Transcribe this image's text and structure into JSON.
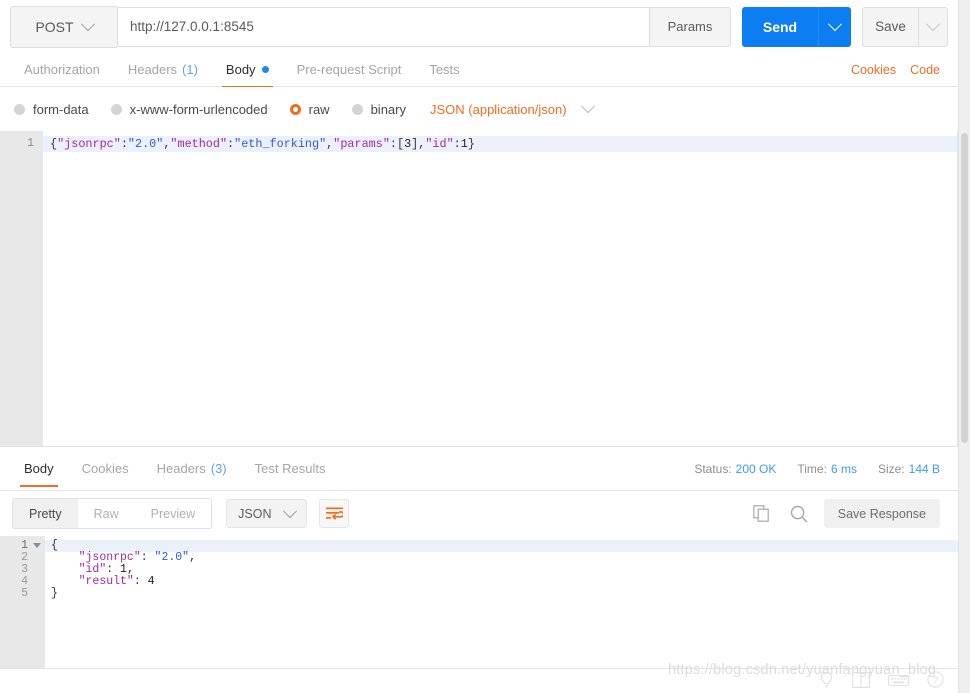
{
  "request": {
    "method": "POST",
    "url": "http://127.0.0.1:8545",
    "params_label": "Params",
    "send_label": "Send",
    "save_label": "Save",
    "tabs": [
      {
        "label": "Authorization",
        "count": "",
        "active": false,
        "dot": false
      },
      {
        "label": "Headers",
        "count": "(1)",
        "active": false,
        "dot": false
      },
      {
        "label": "Body",
        "count": "",
        "active": true,
        "dot": true
      },
      {
        "label": "Pre-request Script",
        "count": "",
        "active": false,
        "dot": false
      },
      {
        "label": "Tests",
        "count": "",
        "active": false,
        "dot": false
      }
    ],
    "right_links": [
      {
        "label": "Cookies"
      },
      {
        "label": "Code"
      }
    ],
    "body_types": [
      {
        "label": "form-data",
        "checked": false
      },
      {
        "label": "x-www-form-urlencoded",
        "checked": false
      },
      {
        "label": "raw",
        "checked": true
      },
      {
        "label": "binary",
        "checked": false
      }
    ],
    "content_type": "JSON (application/json)",
    "body_lines": [
      {
        "number": "1",
        "tokens": [
          {
            "t": "{",
            "k": "pun"
          },
          {
            "t": "\"jsonrpc\"",
            "k": "key"
          },
          {
            "t": ":",
            "k": "pun"
          },
          {
            "t": "\"2.0\"",
            "k": "str"
          },
          {
            "t": ",",
            "k": "pun"
          },
          {
            "t": "\"method\"",
            "k": "key"
          },
          {
            "t": ":",
            "k": "pun"
          },
          {
            "t": "\"eth_forking\"",
            "k": "str"
          },
          {
            "t": ",",
            "k": "pun"
          },
          {
            "t": "\"params\"",
            "k": "key"
          },
          {
            "t": ":[",
            "k": "pun"
          },
          {
            "t": "3",
            "k": "num"
          },
          {
            "t": "],",
            "k": "pun"
          },
          {
            "t": "\"id\"",
            "k": "key"
          },
          {
            "t": ":",
            "k": "pun"
          },
          {
            "t": "1",
            "k": "num"
          },
          {
            "t": "}",
            "k": "pun"
          }
        ]
      }
    ]
  },
  "response": {
    "tabs": [
      {
        "label": "Body",
        "count": "",
        "active": true
      },
      {
        "label": "Cookies",
        "count": "",
        "active": false
      },
      {
        "label": "Headers",
        "count": "(3)",
        "active": false
      },
      {
        "label": "Test Results",
        "count": "",
        "active": false
      }
    ],
    "meta": {
      "status_label": "Status:",
      "status_value": "200 OK",
      "time_label": "Time:",
      "time_value": "6 ms",
      "size_label": "Size:",
      "size_value": "144 B"
    },
    "view_modes": [
      {
        "label": "Pretty",
        "active": true
      },
      {
        "label": "Raw",
        "active": false
      },
      {
        "label": "Preview",
        "active": false
      }
    ],
    "format": "JSON",
    "save_response_label": "Save Response",
    "body_lines": [
      {
        "number": "1",
        "fold": true,
        "tokens": [
          {
            "t": "{",
            "k": "pun"
          }
        ]
      },
      {
        "number": "2",
        "fold": false,
        "tokens": [
          {
            "t": "    ",
            "k": "pun"
          },
          {
            "t": "\"jsonrpc\"",
            "k": "key"
          },
          {
            "t": ": ",
            "k": "pun"
          },
          {
            "t": "\"2.0\"",
            "k": "str"
          },
          {
            "t": ",",
            "k": "pun"
          }
        ]
      },
      {
        "number": "3",
        "fold": false,
        "tokens": [
          {
            "t": "    ",
            "k": "pun"
          },
          {
            "t": "\"id\"",
            "k": "key"
          },
          {
            "t": ": ",
            "k": "pun"
          },
          {
            "t": "1",
            "k": "num"
          },
          {
            "t": ",",
            "k": "pun"
          }
        ]
      },
      {
        "number": "4",
        "fold": false,
        "tokens": [
          {
            "t": "    ",
            "k": "pun"
          },
          {
            "t": "\"result\"",
            "k": "key"
          },
          {
            "t": ": ",
            "k": "pun"
          },
          {
            "t": "4",
            "k": "num"
          }
        ]
      },
      {
        "number": "5",
        "fold": false,
        "tokens": [
          {
            "t": "}",
            "k": "pun"
          }
        ]
      }
    ]
  },
  "footer": {
    "watermark": "https://blog.csdn.net/yuanfangyuan_blog",
    "icons": [
      {
        "name": "bulb-icon"
      },
      {
        "name": "two-pane-icon"
      },
      {
        "name": "keyboard-icon"
      },
      {
        "name": "help-icon"
      }
    ]
  },
  "colors": {
    "accent_orange": "#ef6c23",
    "send_blue": "#0d7ef2",
    "link_blue": "#3e9bf0",
    "json_key": "#a626a4",
    "json_string": "#3a57c7"
  }
}
